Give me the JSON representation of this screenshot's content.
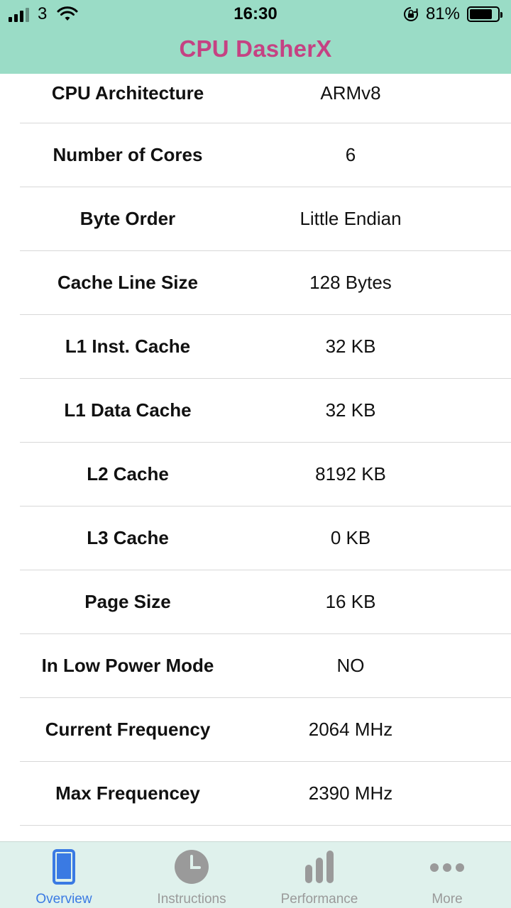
{
  "status": {
    "carrier": "3",
    "time": "16:30",
    "battery_percent": "81%"
  },
  "nav": {
    "title": "CPU DasherX"
  },
  "colors": {
    "header_bg": "#9adcc6",
    "title": "#c54283",
    "tab_active": "#3a7ae3",
    "tab_inactive": "#9a9a9a"
  },
  "rows": [
    {
      "label": "CPU Architecture",
      "value": "ARMv8"
    },
    {
      "label": "Number of Cores",
      "value": "6"
    },
    {
      "label": "Byte Order",
      "value": "Little Endian"
    },
    {
      "label": "Cache Line Size",
      "value": "128 Bytes"
    },
    {
      "label": "L1 Inst. Cache",
      "value": "32 KB"
    },
    {
      "label": "L1 Data Cache",
      "value": "32 KB"
    },
    {
      "label": "L2 Cache",
      "value": "8192 KB"
    },
    {
      "label": "L3 Cache",
      "value": "0 KB"
    },
    {
      "label": "Page Size",
      "value": "16 KB"
    },
    {
      "label": "In Low Power Mode",
      "value": "NO"
    },
    {
      "label": "Current Frequency",
      "value": "2064 MHz"
    },
    {
      "label": "Max Frequencey",
      "value": "2390 MHz"
    }
  ],
  "tabs": [
    {
      "label": "Overview",
      "icon": "phone-icon"
    },
    {
      "label": "Instructions",
      "icon": "clock-icon"
    },
    {
      "label": "Performance",
      "icon": "bar-chart-icon"
    },
    {
      "label": "More",
      "icon": "more-dots-icon"
    }
  ]
}
